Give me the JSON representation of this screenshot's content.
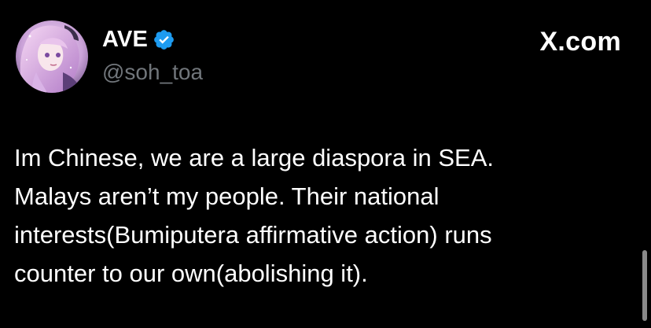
{
  "app": {
    "brand_label": "X.com"
  },
  "author": {
    "display_name": "AVE",
    "handle": "@soh_toa",
    "verified": true,
    "avatar_icon": "profile-avatar-anime-character"
  },
  "tweet": {
    "lines": [
      "Im Chinese, we are a large diaspora in SEA.",
      "Malays aren’t my people. Their national",
      "interests(Bumiputera affirmative action) runs",
      "counter to our own(abolishing it)."
    ]
  },
  "colors": {
    "background": "#000000",
    "text_primary": "#ffffff",
    "text_secondary": "#71767b",
    "verified_blue": "#1d9bf0"
  }
}
